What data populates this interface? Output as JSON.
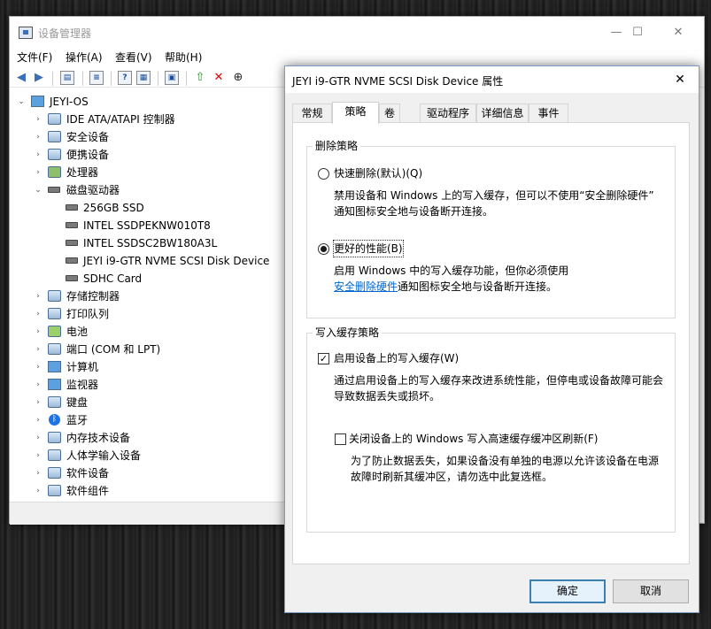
{
  "device_manager": {
    "title": "设备管理器",
    "window_controls": {
      "minimize": "—",
      "maximize": "☐",
      "close": "✕"
    },
    "menu": [
      "文件(F)",
      "操作(A)",
      "查看(V)",
      "帮助(H)"
    ],
    "root": "JEYI-OS",
    "tree": [
      {
        "label": "IDE ATA/ATAPI 控制器",
        "expanded": false,
        "icon": "ide-controller-icon"
      },
      {
        "label": "安全设备",
        "expanded": false,
        "icon": "security-device-icon"
      },
      {
        "label": "便携设备",
        "expanded": false,
        "icon": "portable-device-icon"
      },
      {
        "label": "处理器",
        "expanded": false,
        "icon": "processor-icon"
      },
      {
        "label": "磁盘驱动器",
        "expanded": true,
        "icon": "disk-drive-icon",
        "children": [
          "256GB SSD",
          "INTEL SSDPEKNW010T8",
          "INTEL SSDSC2BW180A3L",
          "JEYI i9-GTR NVME SCSI Disk Device",
          "SDHC Card"
        ]
      },
      {
        "label": "存储控制器",
        "expanded": false,
        "icon": "storage-controller-icon"
      },
      {
        "label": "打印队列",
        "expanded": false,
        "icon": "printer-icon"
      },
      {
        "label": "电池",
        "expanded": false,
        "icon": "battery-icon"
      },
      {
        "label": "端口 (COM 和 LPT)",
        "expanded": false,
        "icon": "port-icon"
      },
      {
        "label": "计算机",
        "expanded": false,
        "icon": "computer-icon"
      },
      {
        "label": "监视器",
        "expanded": false,
        "icon": "monitor-icon"
      },
      {
        "label": "键盘",
        "expanded": false,
        "icon": "keyboard-icon"
      },
      {
        "label": "蓝牙",
        "expanded": false,
        "icon": "bluetooth-icon"
      },
      {
        "label": "内存技术设备",
        "expanded": false,
        "icon": "memory-device-icon"
      },
      {
        "label": "人体学输入设备",
        "expanded": false,
        "icon": "hid-icon"
      },
      {
        "label": "软件设备",
        "expanded": false,
        "icon": "software-device-icon"
      },
      {
        "label": "软件组件",
        "expanded": false,
        "icon": "software-component-icon"
      }
    ]
  },
  "dialog": {
    "title": "JEYI i9-GTR NVME SCSI Disk Device 属性",
    "close_glyph": "✕",
    "tabs": [
      "常规",
      "策略",
      "卷",
      "驱动程序",
      "详细信息",
      "事件"
    ],
    "active_tab": "策略",
    "removal_policy": {
      "title": "删除策略",
      "quick": {
        "label": "快速删除(默认)(Q)",
        "desc_line1": "禁用设备和 Windows 上的写入缓存，但可以不使用“安全删除硬件”",
        "desc_line2": "通知图标安全地与设备断开连接。",
        "selected": false
      },
      "better": {
        "label": "更好的性能(B)",
        "desc_line1": "启用 Windows 中的写入缓存功能，但你必须使用",
        "link": "安全删除硬件",
        "desc_line2_rest": "通知图标安全地与设备断开连接。",
        "selected": true
      }
    },
    "write_cache_policy": {
      "title": "写入缓存策略",
      "enable": {
        "label": "启用设备上的写入缓存(W)",
        "checked": true,
        "desc_line1": "通过启用设备上的写入缓存来改进系统性能，但停电或设备故障可能会",
        "desc_line2": "导致数据丢失或损坏。"
      },
      "flush": {
        "label": "关闭设备上的 Windows 写入高速缓存缓冲区刷新(F)",
        "checked": false,
        "desc_line1": "为了防止数据丢失，如果设备没有单独的电源以允许该设备在电源",
        "desc_line2": "故障时刷新其缓冲区，请勿选中此复选框。"
      }
    },
    "ok_label": "确定",
    "cancel_label": "取消"
  }
}
